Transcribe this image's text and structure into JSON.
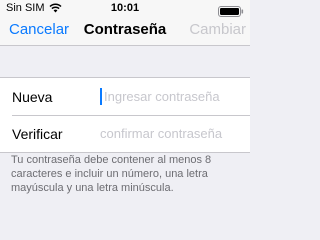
{
  "status_bar": {
    "carrier": "Sin SIM",
    "time": "10:01",
    "wifi_icon": "wifi-icon",
    "battery_icon": "battery-icon"
  },
  "nav": {
    "cancel_label": "Cancelar",
    "title": "Contraseña",
    "change_label": "Cambiar"
  },
  "form": {
    "new_label": "Nueva",
    "new_placeholder": "Ingresar contraseña",
    "verify_label": "Verificar",
    "verify_placeholder": "confirmar contraseña"
  },
  "footer_note": "Tu contraseña debe contener al menos 8 caracteres e incluir un número, una letra mayúscula y una letra minúscula."
}
